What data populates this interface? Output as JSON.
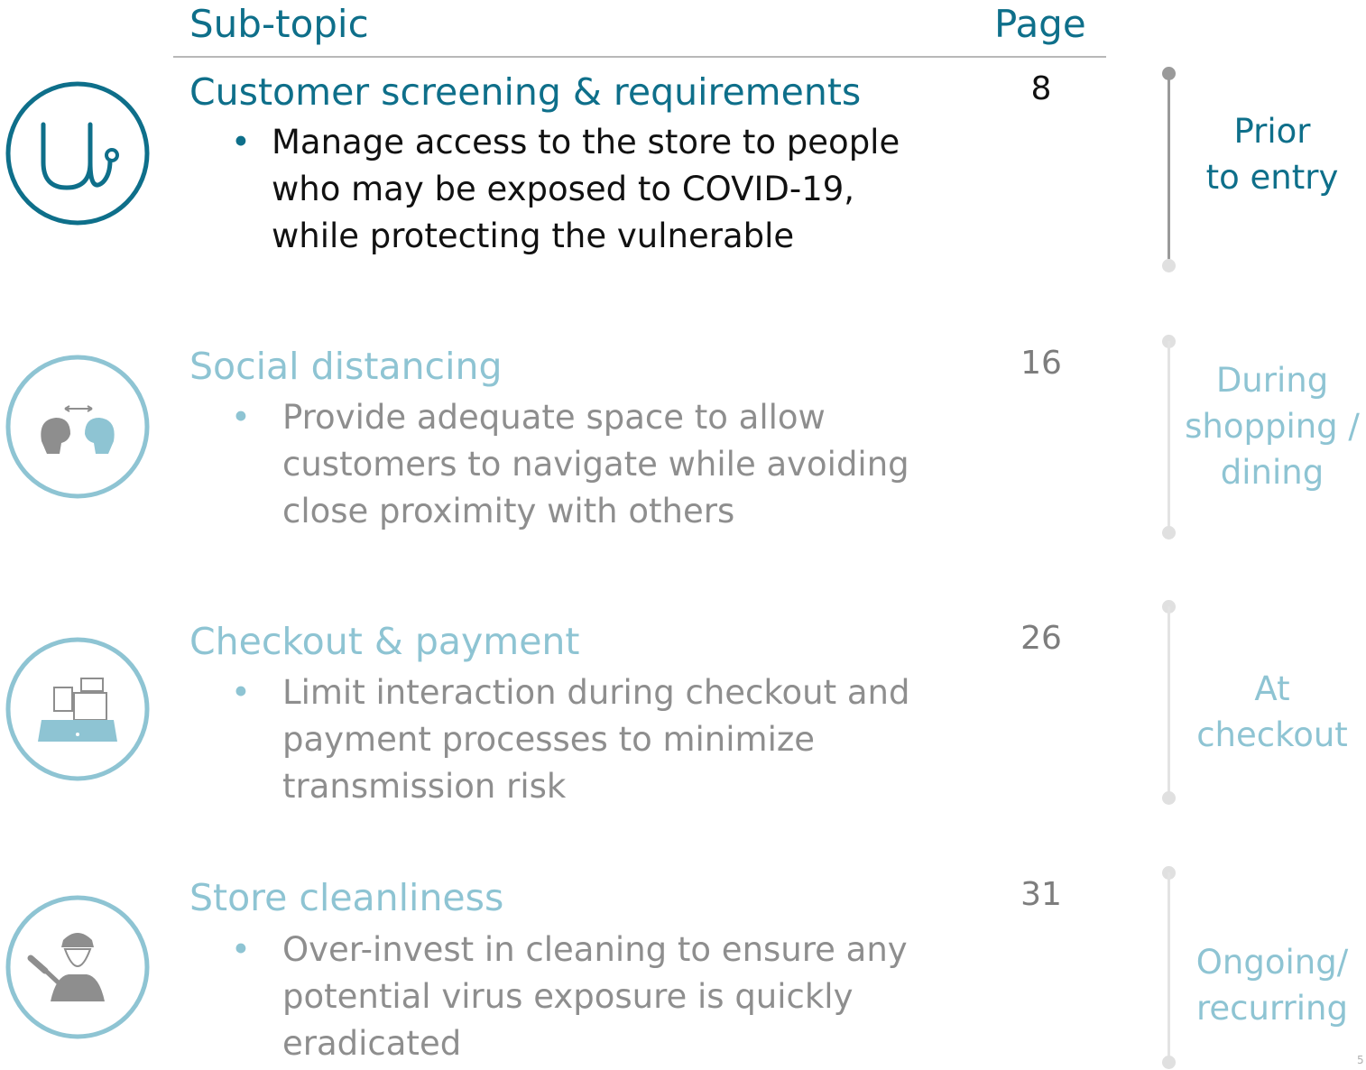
{
  "header": {
    "subtopic_label": "Sub-topic",
    "page_label": "Page"
  },
  "sections": [
    {
      "title": "Customer screening & requirements",
      "bullet_lines": [
        "Manage access to the store to people",
        "who may be exposed to COVID-19,",
        "while protecting the vulnerable"
      ],
      "page": "8",
      "phase_lines": [
        "Prior",
        "to entry"
      ],
      "icon": "stethoscope-icon",
      "active": true
    },
    {
      "title": "Social distancing",
      "bullet_lines": [
        "Provide adequate space to allow",
        "customers to navigate while avoiding",
        "close proximity with others"
      ],
      "page": "16",
      "phase_lines": [
        "During",
        "shopping /",
        "dining"
      ],
      "icon": "distancing-heads-icon",
      "active": false
    },
    {
      "title": "Checkout & payment",
      "bullet_lines": [
        "Limit interaction during checkout and",
        "payment processes to minimize",
        "transmission risk"
      ],
      "page": "26",
      "phase_lines": [
        "At",
        "checkout"
      ],
      "icon": "cash-register-icon",
      "active": false
    },
    {
      "title": "Store cleanliness",
      "bullet_lines": [
        "Over-invest in cleaning to ensure any",
        "potential virus exposure is quickly",
        "eradicated"
      ],
      "page": "31",
      "phase_lines": [
        "Ongoing/",
        "recurring"
      ],
      "icon": "cleaner-icon",
      "active": false
    }
  ],
  "colors": {
    "active": "#0e6f8a",
    "inactive": "#8ec4d3",
    "active_text": "#111111",
    "inactive_text": "#8e8e8e"
  },
  "footnote": "5"
}
